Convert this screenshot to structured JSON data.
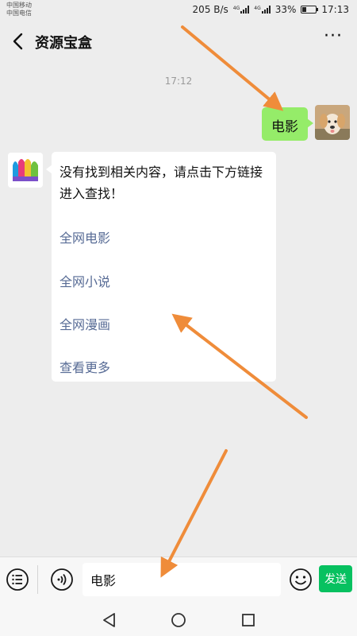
{
  "status_bar": {
    "carrier_line1": "中国移动",
    "carrier_line2": "中国电信",
    "network_speed": "205 B/s",
    "signal1_label": "4G",
    "signal2_label": "4G",
    "battery_percent": "33%",
    "battery_level": 0.33,
    "time": "17:13"
  },
  "header": {
    "title": "资源宝盒",
    "back_icon": "chevron-left-icon",
    "more_icon": "more-dots-icon",
    "more_label": "···"
  },
  "chat": {
    "timestamp": "17:12",
    "outgoing": {
      "text": "电影",
      "avatar": "puppy-photo"
    },
    "incoming": {
      "avatar": "colorful-app-logo",
      "text": "没有找到相关内容，请点击下方链接进入查找！",
      "links": [
        "全网电影",
        "全网小说",
        "全网漫画",
        "查看更多"
      ]
    }
  },
  "input_bar": {
    "menu_icon": "list-menu-icon",
    "voice_icon": "voice-icon",
    "input_value": "电影",
    "emoji_icon": "smiley-icon",
    "send_label": "发送"
  },
  "nav_bar": {
    "back_icon": "triangle-back-icon",
    "home_icon": "circle-home-icon",
    "recent_icon": "square-recent-icon"
  },
  "colors": {
    "background": "#ededed",
    "outgoing_bubble": "#95ec69",
    "link": "#576b95",
    "send_button": "#07c160",
    "annotation_arrow": "#ef8c3a"
  }
}
